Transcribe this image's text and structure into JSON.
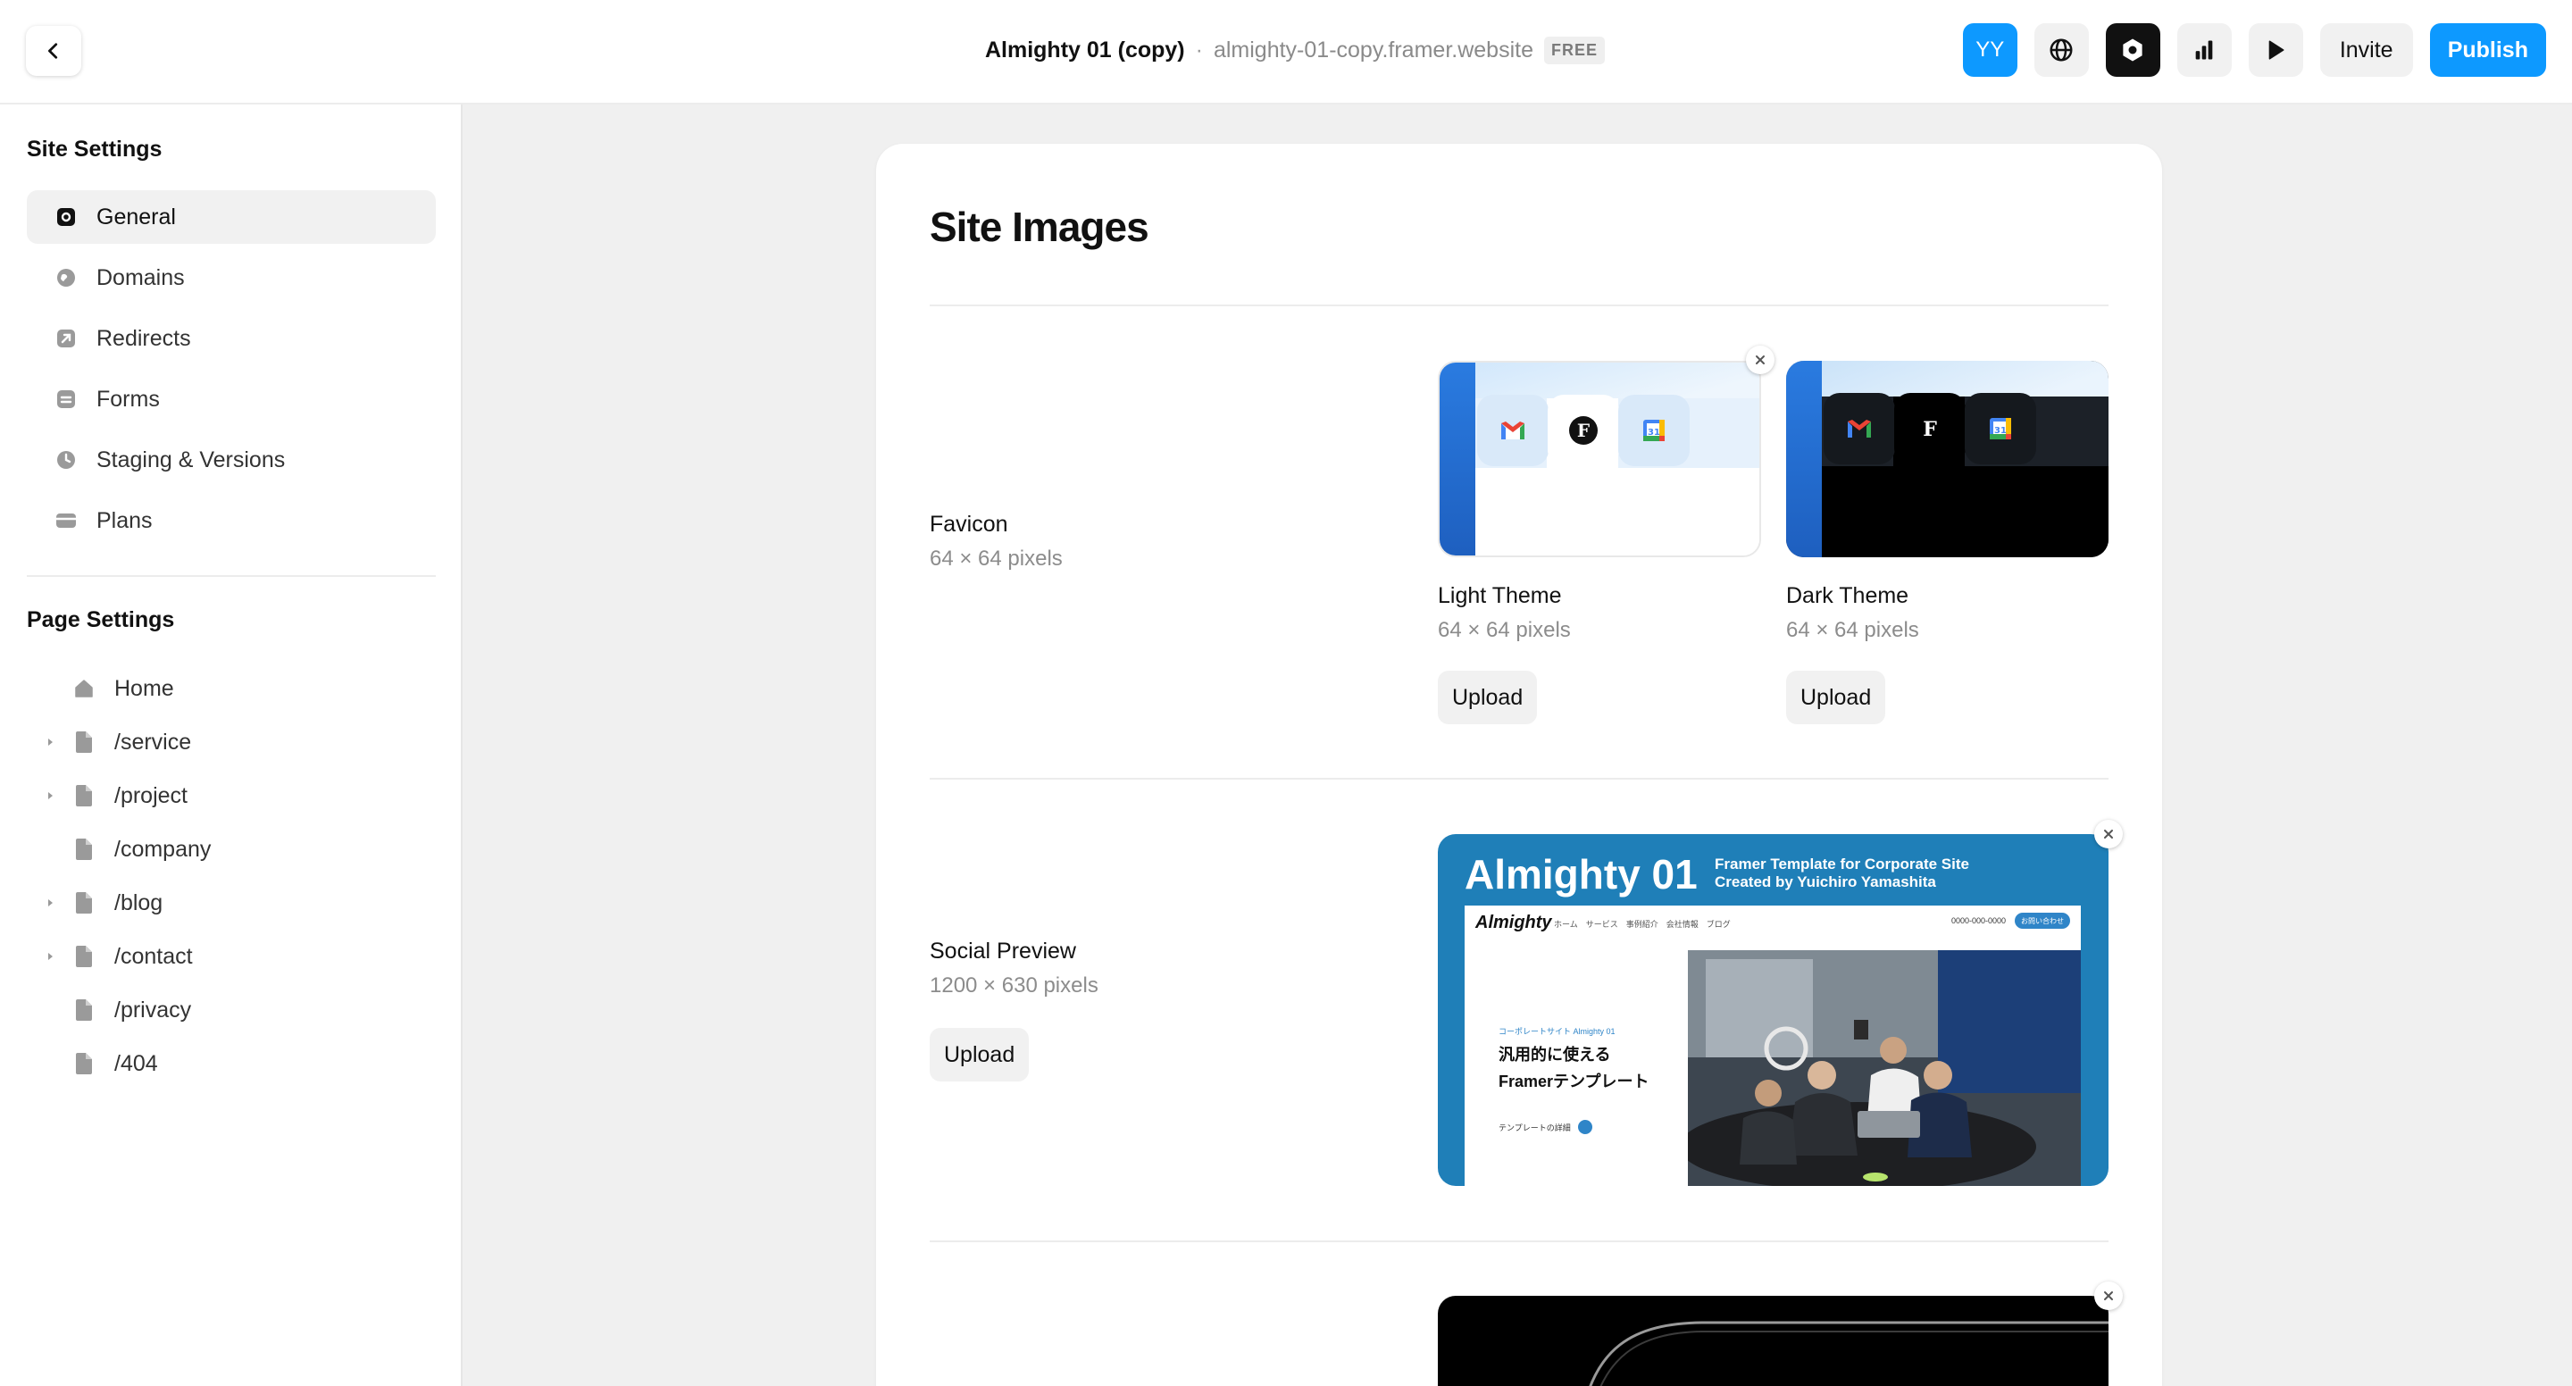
{
  "header": {
    "project_title": "Almighty 01 (copy)",
    "separator": "·",
    "site_url": "almighty-01-copy.framer.website",
    "plan_badge": "FREE",
    "avatar_initials": "YY",
    "invite_label": "Invite",
    "publish_label": "Publish",
    "accent_color": "#0d99ff"
  },
  "sidebar": {
    "site_settings_heading": "Site Settings",
    "site_items": [
      {
        "label": "General",
        "icon": "gear-icon",
        "active": true
      },
      {
        "label": "Domains",
        "icon": "globe-icon"
      },
      {
        "label": "Redirects",
        "icon": "redirect-icon"
      },
      {
        "label": "Forms",
        "icon": "form-icon"
      },
      {
        "label": "Staging & Versions",
        "icon": "clock-icon"
      },
      {
        "label": "Plans",
        "icon": "card-icon"
      }
    ],
    "page_settings_heading": "Page Settings",
    "pages": [
      {
        "label": "Home",
        "icon": "home-icon",
        "expandable": false
      },
      {
        "label": "/service",
        "icon": "page-icon",
        "expandable": true
      },
      {
        "label": "/project",
        "icon": "page-icon",
        "expandable": true
      },
      {
        "label": "/company",
        "icon": "page-icon",
        "expandable": false
      },
      {
        "label": "/blog",
        "icon": "page-icon",
        "expandable": true
      },
      {
        "label": "/contact",
        "icon": "page-icon",
        "expandable": true
      },
      {
        "label": "/privacy",
        "icon": "page-icon",
        "expandable": false
      },
      {
        "label": "/404",
        "icon": "page-icon",
        "expandable": false
      }
    ]
  },
  "main": {
    "title": "Site Images",
    "favicon": {
      "label": "Favicon",
      "size": "64 × 64 pixels",
      "light": {
        "label": "Light Theme",
        "size": "64 × 64 pixels",
        "upload_label": "Upload"
      },
      "dark": {
        "label": "Dark Theme",
        "size": "64 × 64 pixels",
        "upload_label": "Upload"
      }
    },
    "social_preview": {
      "label": "Social Preview",
      "size": "1200 × 630 pixels",
      "upload_label": "Upload",
      "preview": {
        "heading": "Almighty 01",
        "tagline_1": "Framer Template for Corporate Site",
        "tagline_2": "Created by Yuichiro Yamashita",
        "logo": "Almighty",
        "nav": "ホーム　サービス　事例紹介　会社情報　ブログ",
        "phone": "0000-000-0000",
        "cta": "お問い合わせ",
        "small_heading": "コーポレートサイト Almighty 01",
        "main_line_1": "汎用的に使える",
        "main_line_2": "Framerテンプレート",
        "link_text": "テンプレートの詳細",
        "brand_color": "#1f7fb8"
      }
    }
  }
}
